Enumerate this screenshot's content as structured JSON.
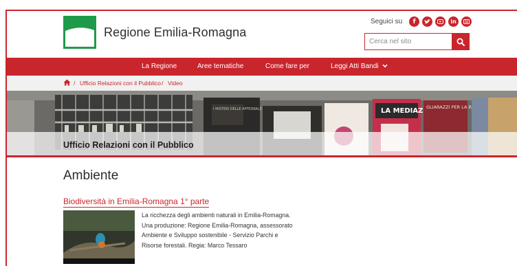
{
  "header": {
    "site_title": "Regione Emilia-Romagna",
    "follow_label": "Seguici su",
    "social_icons": [
      "facebook-icon",
      "twitter-icon",
      "youtube-icon",
      "linkedin-icon",
      "rss-icon"
    ],
    "search_placeholder": "Cerca nel sito"
  },
  "nav": {
    "items": [
      "La Regione",
      "Aree tematiche",
      "Come fare per",
      "Leggi Atti Bandi"
    ]
  },
  "breadcrumb": {
    "items": [
      "Ufficio Relazioni con il Pubblico",
      "Video"
    ],
    "separator": "/"
  },
  "banner": {
    "title": "Ufficio Relazioni con il Pubblico",
    "posters": [
      "I MISTERI DELLE AFFEDRALE",
      "LA MEDIAZION",
      "GLIARAZZI PER LA REGIONE EMILIA-ROMAGNA"
    ]
  },
  "main": {
    "heading": "Ambiente",
    "article": {
      "title": "Biodiversità in Emilia-Romagna 1° parte",
      "description_lines": [
        "La ricchezza degli ambienti naturali in Emilia-Romagna.",
        "Una produzione: Regione Emilia-Romagna, assessorato",
        "Ambiente e Sviluppo sostenibile - Servizio Parchi e",
        "Risorse forestali. Regia: Marco Tessaro"
      ]
    }
  },
  "colors": {
    "brand_red": "#c9252c",
    "logo_green": "#1f9a4a"
  }
}
